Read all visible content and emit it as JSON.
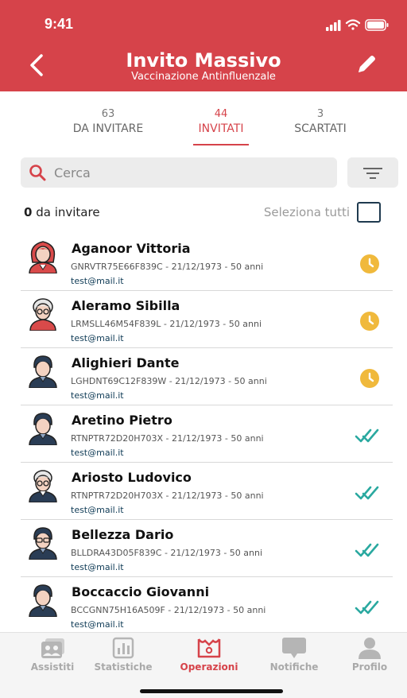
{
  "status_bar": {
    "time": "9:41"
  },
  "header": {
    "title": "Invito Massivo",
    "subtitle": "Vaccinazione Antinfluenzale",
    "color": "#d6434a"
  },
  "tabs": [
    {
      "count": "63",
      "label": "DA INVITARE",
      "active": false
    },
    {
      "count": "44",
      "label": "INVITATI",
      "active": true
    },
    {
      "count": "3",
      "label": "SCARTATI",
      "active": false
    }
  ],
  "search": {
    "placeholder": "Cerca"
  },
  "selection": {
    "count": "0",
    "count_suffix": "da invitare",
    "select_all_label": "Seleziona tutti"
  },
  "patients": [
    {
      "name": "Aganoor Vittoria",
      "details": "GNRVTR75E66F839C -  21/12/1973 - 50 anni",
      "email": "test@mail.it",
      "status": "pending",
      "avatar": "female-red-hair"
    },
    {
      "name": "Aleramo Sibilla",
      "details": "LRMSLL46M54F839L - 21/12/1973 - 50 anni",
      "email": "test@mail.it",
      "status": "pending",
      "avatar": "female-elder-glasses"
    },
    {
      "name": "Alighieri Dante",
      "details": "LGHDNT69C12F839W - 21/12/1973 - 50 anni",
      "email": "test@mail.it",
      "status": "pending",
      "avatar": "male-dark-hair"
    },
    {
      "name": "Aretino Pietro",
      "details": "RTNPTR72D20H703X - 21/12/1973 - 50 anni",
      "email": "test@mail.it",
      "status": "delivered",
      "avatar": "male-dark-hair"
    },
    {
      "name": "Ariosto Ludovico",
      "details": "RTNPTR72D20H703X - 21/12/1973 - 50 anni",
      "email": "test@mail.it",
      "status": "delivered",
      "avatar": "male-elder-glasses"
    },
    {
      "name": "Bellezza Dario",
      "details": "BLLDRA43D05F839C - 21/12/1973 - 50 anni",
      "email": "test@mail.it",
      "status": "delivered",
      "avatar": "male-glasses"
    },
    {
      "name": "Boccaccio Giovanni",
      "details": "BCCGNN75H16A509F - 21/12/1973 - 50 anni",
      "email": "test@mail.it",
      "status": "delivered",
      "avatar": "male-dark-hair"
    }
  ],
  "status_colors": {
    "pending": "#f0b93c",
    "delivered": "#2aa9a0"
  },
  "bottom_nav": [
    {
      "label": "Assistiti",
      "icon": "patients-icon",
      "active": false
    },
    {
      "label": "Statistiche",
      "icon": "chart-icon",
      "active": false
    },
    {
      "label": "Operazioni",
      "icon": "operations-icon",
      "active": true
    },
    {
      "label": "Notifiche",
      "icon": "chat-bubble-icon",
      "active": false
    },
    {
      "label": "Profilo",
      "icon": "user-icon",
      "active": false
    }
  ]
}
